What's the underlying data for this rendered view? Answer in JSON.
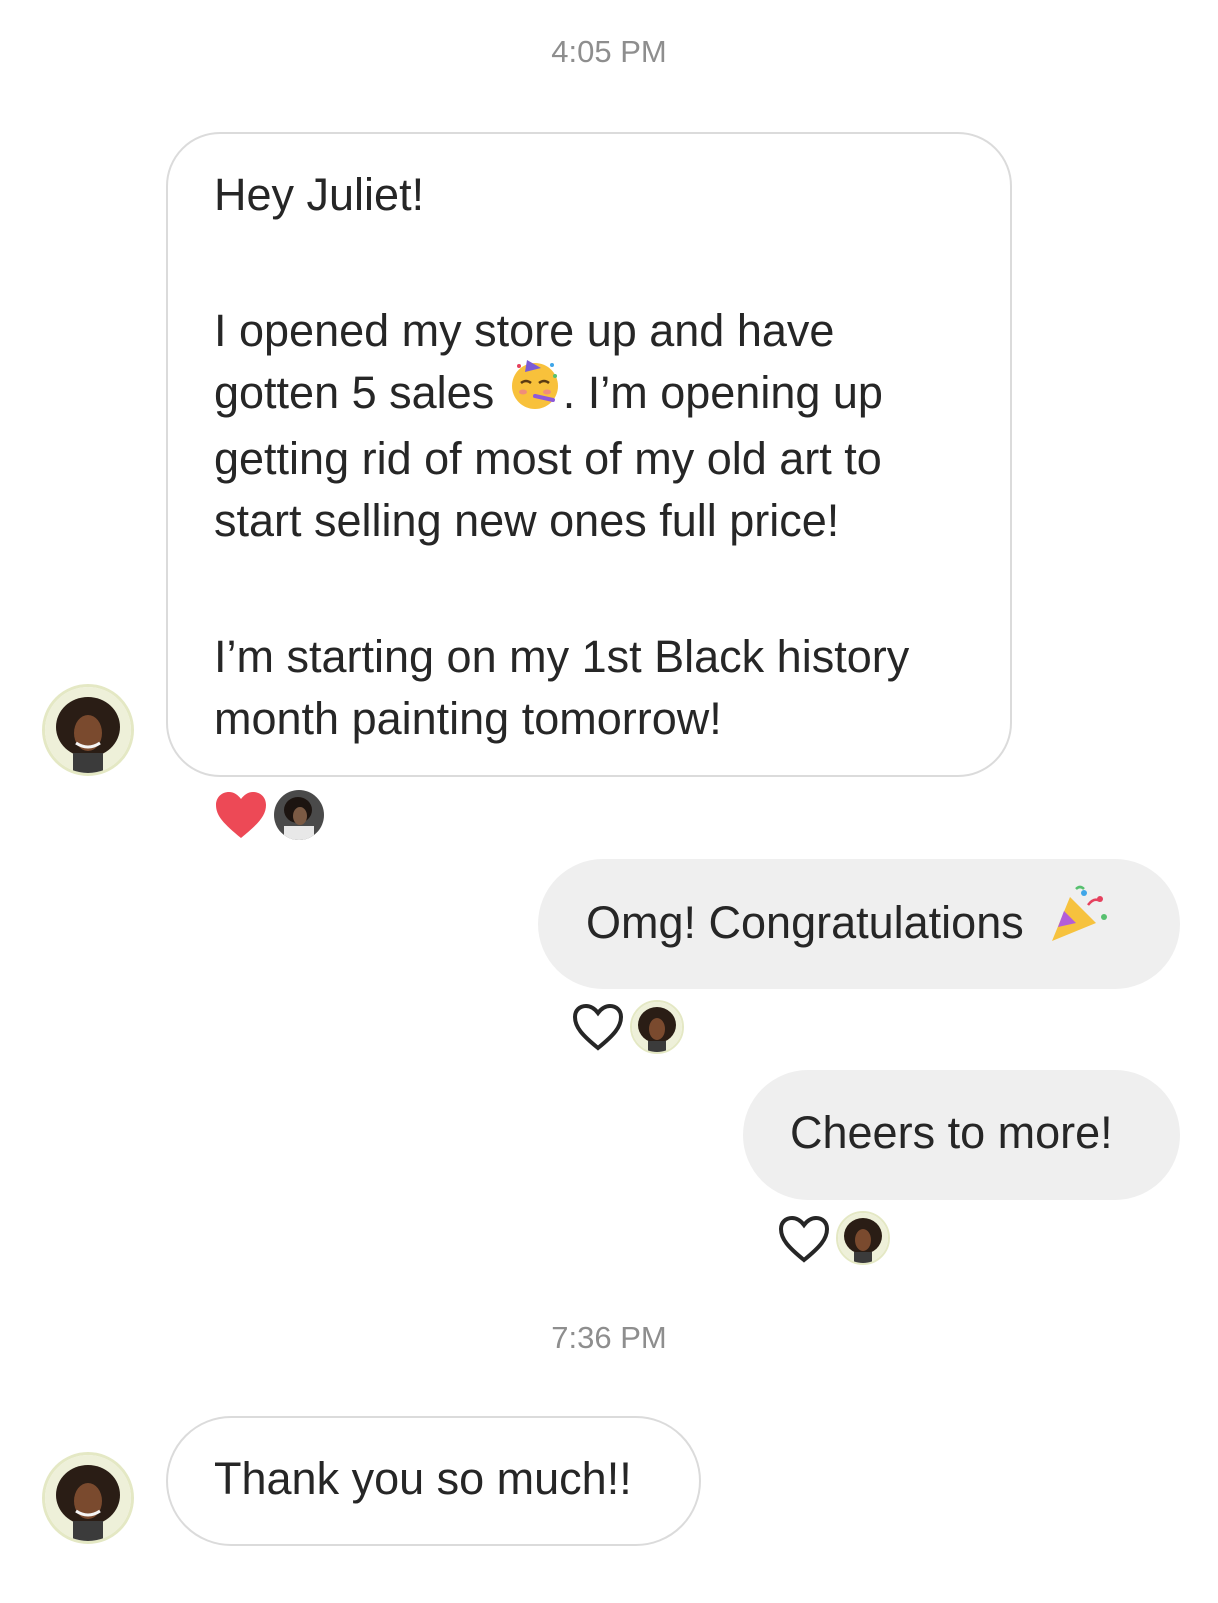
{
  "thread": {
    "timestamps": [
      "4:05 PM",
      "7:36 PM"
    ],
    "messages": [
      {
        "sender": "other",
        "paragraphs": [
          "Hey Juliet!",
          "I opened my store up and have gotten 5 sales",
          ". I’m opening up getting rid of most of my old art to start selling new ones full price!",
          "I’m starting on my 1st Black history month painting tomorrow!"
        ],
        "emoji": "partying-face-emoji",
        "reactions": [
          "heart-filled-icon"
        ]
      },
      {
        "sender": "me",
        "text": "Omg! Congratulations",
        "emoji": "party-popper-emoji",
        "reactions": [
          "heart-outline-icon"
        ]
      },
      {
        "sender": "me",
        "text": "Cheers to more!",
        "reactions": [
          "heart-outline-icon"
        ]
      },
      {
        "sender": "other",
        "text": "Thank you so much!!"
      }
    ]
  },
  "colors": {
    "incoming_border": "#dbdbdb",
    "outgoing_bg": "#efefef",
    "heart_filled": "#ed4956",
    "text": "#262626",
    "timestamp": "#8e8e8e"
  }
}
